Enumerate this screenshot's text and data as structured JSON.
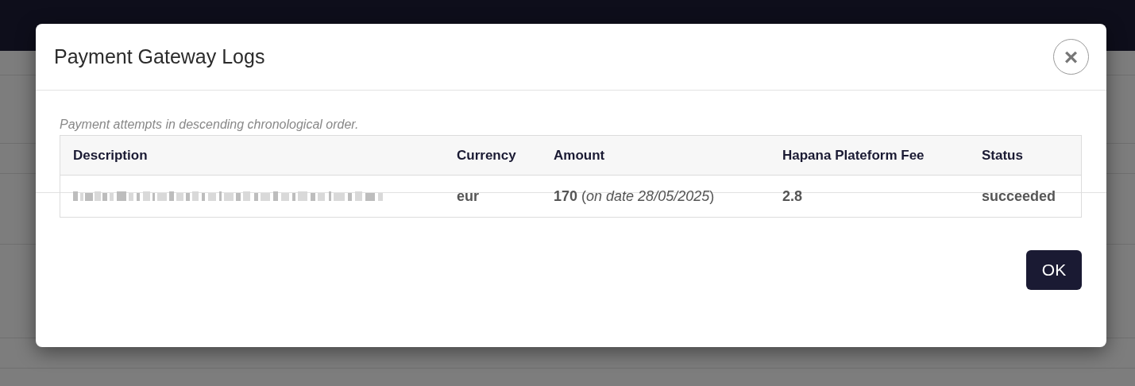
{
  "dialog": {
    "title": "Payment Gateway Logs",
    "close_label": "×",
    "subtitle": "Payment attempts in descending chronological order.",
    "table": {
      "columns": [
        "Description",
        "Currency",
        "Amount",
        "Hapana Plateform Fee",
        "Status"
      ],
      "rows": [
        {
          "cells": [
            {
              "kind": "redacted"
            },
            {
              "kind": "text",
              "text": "eur"
            },
            {
              "kind": "rich",
              "text": "**170** (*on date 28/05/2025*)"
            },
            {
              "kind": "text",
              "text": "2.8"
            },
            {
              "kind": "text",
              "text": "succeeded"
            }
          ]
        }
      ]
    },
    "buttons": [
      {
        "label": "OK"
      }
    ]
  }
}
